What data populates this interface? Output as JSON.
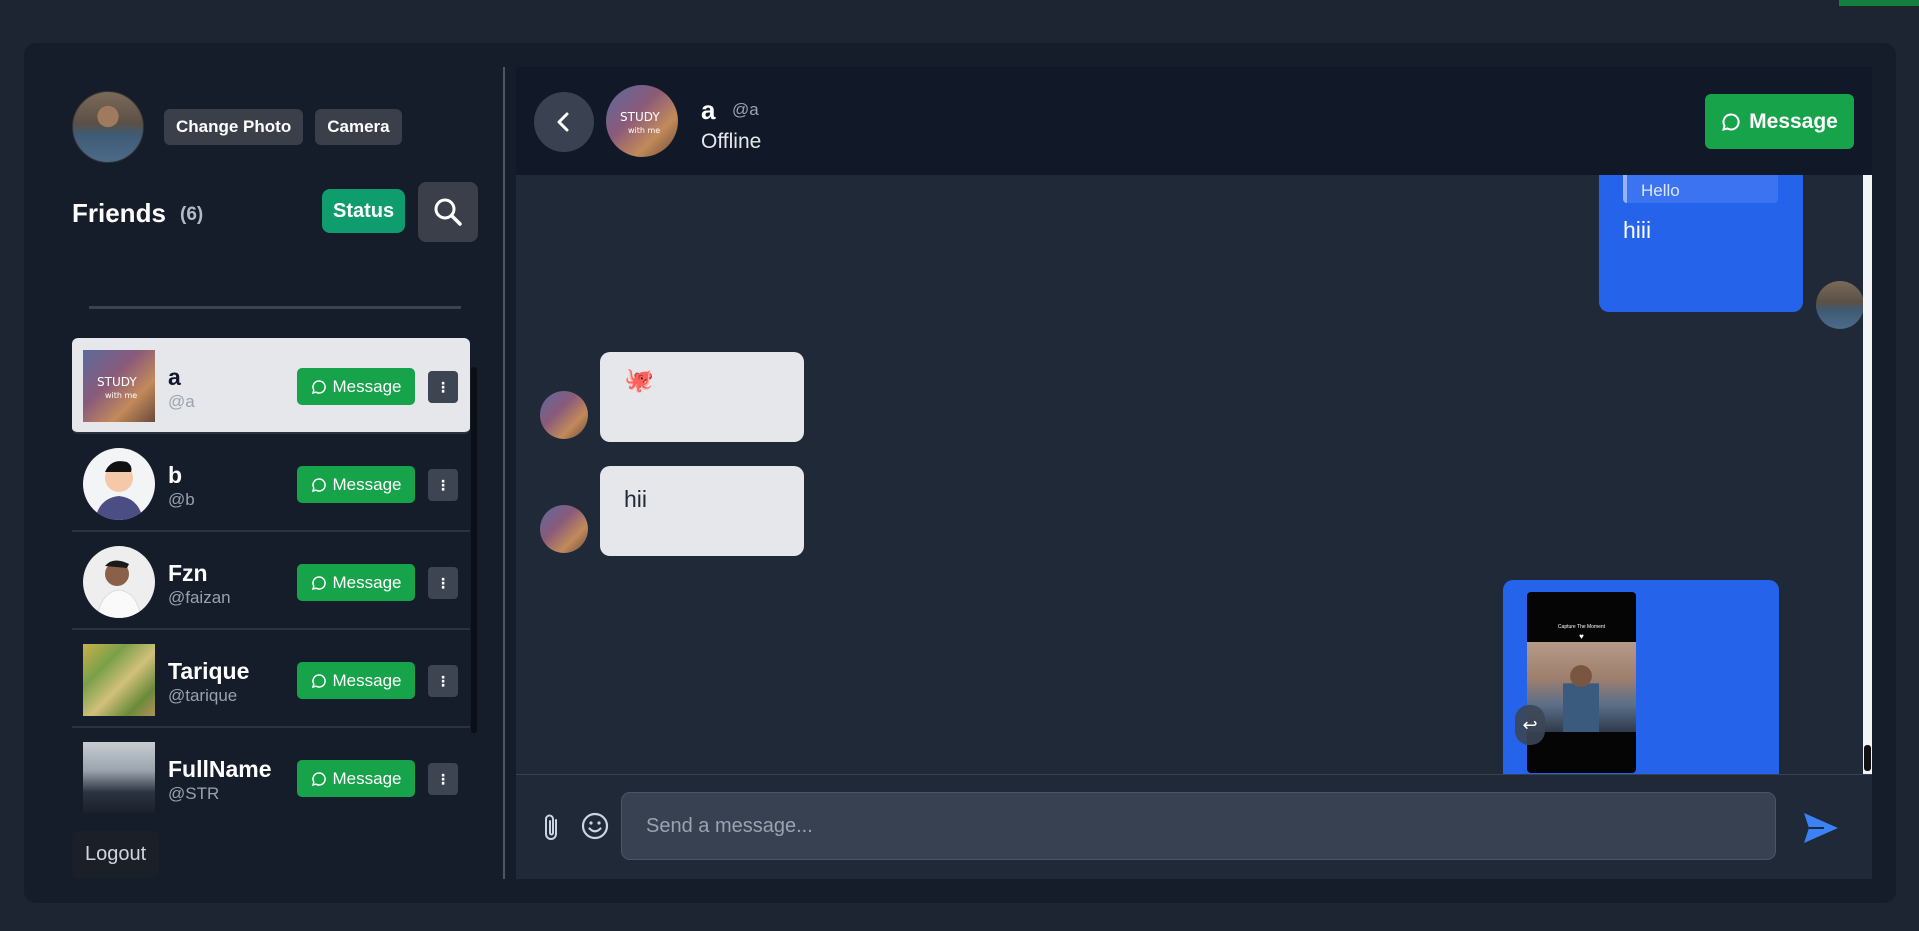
{
  "sidebar": {
    "change_photo_label": "Change Photo",
    "camera_label": "Camera",
    "friends_title": "Friends",
    "friends_count": "(6)",
    "status_label": "Status",
    "friends": [
      {
        "name": "a",
        "username": "@a",
        "message_label": "Message",
        "more": "⋮"
      },
      {
        "name": "b",
        "username": "@b",
        "message_label": "Message",
        "more": "⋮"
      },
      {
        "name": "Fzn",
        "username": "@faizan",
        "message_label": "Message",
        "more": "⋮"
      },
      {
        "name": "Tarique",
        "username": "@tarique",
        "message_label": "Message",
        "more": "⋮"
      },
      {
        "name": "FullName",
        "username": "@STR",
        "message_label": "Message",
        "more": "⋮"
      }
    ],
    "logout_label": "Logout"
  },
  "chat": {
    "header": {
      "name": "a",
      "username": "@a",
      "status": "Offline",
      "message_label": "Message"
    },
    "messages": [
      {
        "from": "me",
        "reply_to": "Hello",
        "text": "hiii"
      },
      {
        "from": "them",
        "text": "🐙"
      },
      {
        "from": "them",
        "text": "hii"
      },
      {
        "from": "me",
        "image_caption": "Capture The Moment",
        "image_heart": "♥"
      }
    ],
    "input": {
      "placeholder": "Send a message..."
    }
  },
  "colors": {
    "accent_green": "#16a34a",
    "status_green": "#0f9d6e",
    "my_bubble": "#2563eb",
    "their_bubble": "#e5e7eb",
    "send_icon": "#3b82f6"
  },
  "icons": {
    "search": "search-icon",
    "back": "chevron-left-icon",
    "message": "chat-bubble-icon",
    "attach": "paperclip-icon",
    "emoji": "smiley-icon",
    "send": "send-icon",
    "reply": "reply-icon",
    "more": "more-vertical-icon"
  }
}
